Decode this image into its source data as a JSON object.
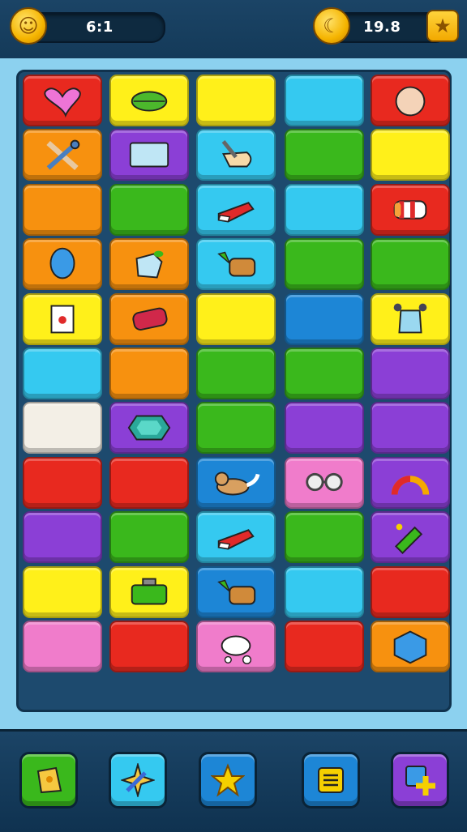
{
  "hud": {
    "left_counter": {
      "value": "6:1",
      "icon": "gold-coin-icon"
    },
    "right_counter": {
      "value": "19.8",
      "icon": "crescent-coin-icon"
    },
    "corner_button_icon": "star-badge-icon"
  },
  "colors": {
    "red": "#e8291f",
    "yellow": "#fff01a",
    "cyan": "#35c9f0",
    "orange": "#f7910f",
    "purple": "#8b3fd6",
    "green": "#3ab81c",
    "white": "#f3efe6",
    "pink": "#f07ccb",
    "blue": "#1d86d6"
  },
  "grid": {
    "columns": 5,
    "rows": 11,
    "tiles": [
      {
        "color": "red",
        "icon": "pink-heart-shape-icon"
      },
      {
        "color": "yellow",
        "icon": "green-leaf-icon"
      },
      {
        "color": "yellow",
        "icon": "cat-face-icon"
      },
      {
        "color": "cyan",
        "icon": "seal-face-icon"
      },
      {
        "color": "red",
        "icon": "peach-icon"
      },
      {
        "color": "orange",
        "icon": "crossed-tools-icon"
      },
      {
        "color": "purple",
        "icon": "glass-panel-icon"
      },
      {
        "color": "cyan",
        "icon": "hand-tool-icon"
      },
      {
        "color": "green",
        "icon": "red-apple-icon"
      },
      {
        "color": "yellow",
        "icon": "purple-bear-icon"
      },
      {
        "color": "orange",
        "icon": "green-heart-icon"
      },
      {
        "color": "green",
        "icon": "green-block-icon"
      },
      {
        "color": "cyan",
        "icon": "red-shoe-icon"
      },
      {
        "color": "cyan",
        "icon": "yellow-ring-icon"
      },
      {
        "color": "red",
        "icon": "striped-candy-icon"
      },
      {
        "color": "orange",
        "icon": "blue-balloon-icon"
      },
      {
        "color": "orange",
        "icon": "ice-cube-icon"
      },
      {
        "color": "cyan",
        "icon": "carrot-bread-icon"
      },
      {
        "color": "green",
        "icon": "pink-heart-icon"
      },
      {
        "color": "green",
        "icon": "green-block-icon"
      },
      {
        "color": "yellow",
        "icon": "card-icon"
      },
      {
        "color": "orange",
        "icon": "log-icon"
      },
      {
        "color": "yellow",
        "icon": "lemon-icon"
      },
      {
        "color": "blue",
        "icon": "pink-heart-icon"
      },
      {
        "color": "yellow",
        "icon": "glass-bottle-icon"
      },
      {
        "color": "cyan",
        "icon": "bear-face-icon"
      },
      {
        "color": "orange",
        "icon": "plum-icon"
      },
      {
        "color": "green",
        "icon": "chick-face-icon"
      },
      {
        "color": "green",
        "icon": "green-block-icon"
      },
      {
        "color": "purple",
        "icon": "white-ring-icon"
      },
      {
        "color": "white",
        "icon": "orange-fruit-icon"
      },
      {
        "color": "purple",
        "icon": "hexagon-gem-icon"
      },
      {
        "color": "green",
        "icon": "radish-icon"
      },
      {
        "color": "purple",
        "icon": "pink-heart-icon"
      },
      {
        "color": "purple",
        "icon": "green-ball-icon"
      },
      {
        "color": "red",
        "icon": "pink-apple-icon"
      },
      {
        "color": "red",
        "icon": "seal-face-icon"
      },
      {
        "color": "blue",
        "icon": "cat-lying-icon"
      },
      {
        "color": "pink",
        "icon": "glasses-icon"
      },
      {
        "color": "purple",
        "icon": "rainbow-arc-icon"
      },
      {
        "color": "purple",
        "icon": "green-ball-icon"
      },
      {
        "color": "green",
        "icon": "fox-face-icon"
      },
      {
        "color": "cyan",
        "icon": "red-shoe-icon"
      },
      {
        "color": "green",
        "icon": "bear-face-icon"
      },
      {
        "color": "purple",
        "icon": "pencil-icon"
      },
      {
        "color": "yellow",
        "icon": "blue-bug-icon"
      },
      {
        "color": "yellow",
        "icon": "green-case-icon"
      },
      {
        "color": "blue",
        "icon": "carrot-bread-icon"
      },
      {
        "color": "cyan",
        "icon": "fox-face-icon"
      },
      {
        "color": "red",
        "icon": "pink-heart-icon"
      },
      {
        "color": "pink",
        "icon": "bear-face-icon"
      },
      {
        "color": "red",
        "icon": "purple-ring-icon"
      },
      {
        "color": "pink",
        "icon": "white-bird-icon"
      },
      {
        "color": "red",
        "icon": "blue-heart-icon"
      },
      {
        "color": "orange",
        "icon": "blue-cube-icon"
      }
    ]
  },
  "toolbar": [
    {
      "color": "#3ab81c",
      "icon": "map-icon"
    },
    {
      "color": "#35c9f0",
      "icon": "rocket-icon"
    },
    {
      "color": "#1d86d6",
      "icon": "star-icon"
    },
    {
      "color": "#1d86d6",
      "icon": "list-icon"
    },
    {
      "color": "#8b3fd6",
      "icon": "add-icon"
    }
  ]
}
